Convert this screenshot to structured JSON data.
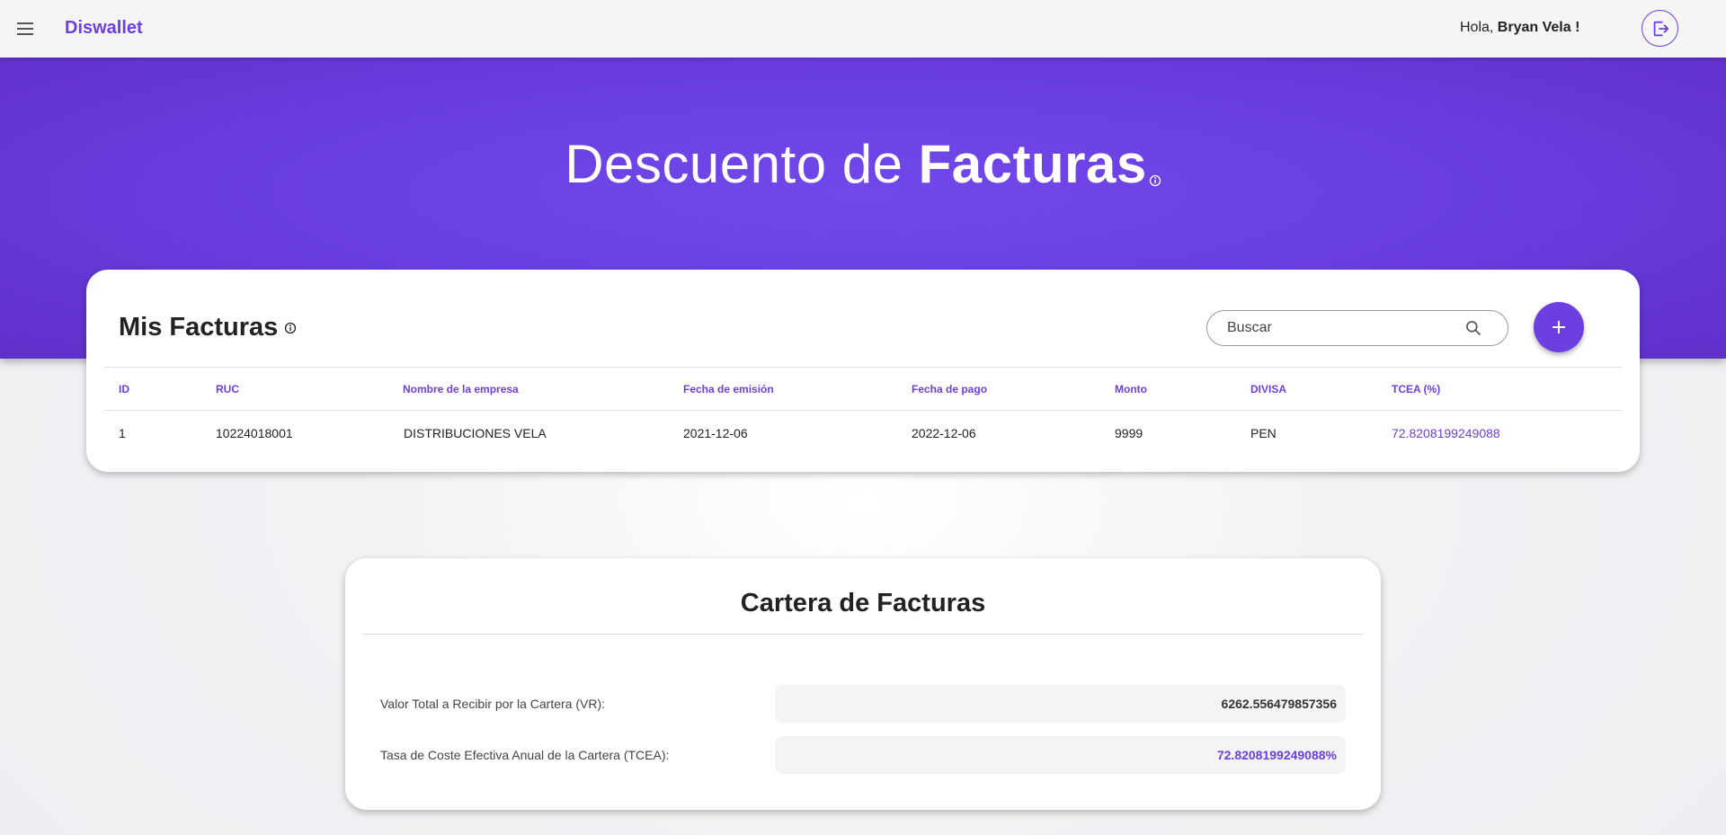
{
  "app": {
    "brand": "Diswallet",
    "greeting_prefix": "Hola, ",
    "user_name": "Bryan Vela !"
  },
  "hero": {
    "title_light": "Descuento de ",
    "title_bold": "Facturas"
  },
  "invoices": {
    "title": "Mis Facturas",
    "search_placeholder": "Buscar",
    "columns": [
      "ID",
      "RUC",
      "Nombre de la empresa",
      "Fecha de emisión",
      "Fecha de pago",
      "Monto",
      "DIVISA",
      "TCEA (%)"
    ],
    "rows": [
      [
        "1",
        "10224018001",
        "DISTRIBUCIONES VELA",
        "2021-12-06",
        "2022-12-06",
        "9999",
        "PEN",
        "72.8208199249088"
      ]
    ]
  },
  "portfolio": {
    "title": "Cartera de Facturas",
    "vr_label": "Valor Total a Recibir por la Cartera (VR):",
    "vr_value": "6262.556479857356",
    "tcea_label": "Tasa de Coste Efectiva Anual de la Cartera (TCEA):",
    "tcea_value": "72.8208199249088%"
  },
  "colors": {
    "accent": "#6c3fe0",
    "hero_bg": "#6a3fe2",
    "topbar_bg": "#f5f5f5"
  },
  "icons": [
    "menu-icon",
    "logout-icon",
    "info-icon",
    "search-icon",
    "plus-icon"
  ]
}
